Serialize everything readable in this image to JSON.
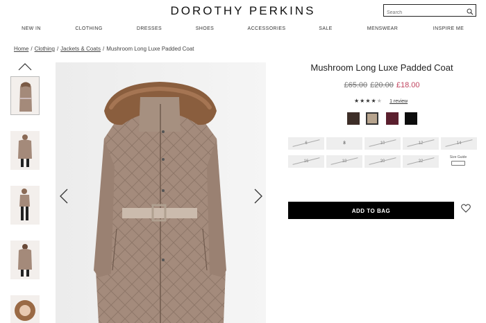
{
  "brand": {
    "logo": "DOROTHY PERKINS"
  },
  "search": {
    "placeholder": "Search"
  },
  "nav": [
    "NEW IN",
    "CLOTHING",
    "DRESSES",
    "SHOES",
    "ACCESSORIES",
    "SALE",
    "MENSWEAR",
    "INSPIRE ME"
  ],
  "breadcrumb": {
    "items": [
      "Home",
      "Clothing",
      "Jackets & Coats"
    ],
    "current": "Mushroom Long Luxe Padded Coat",
    "separator": "/"
  },
  "product": {
    "title": "Mushroom Long Luxe Padded Coat",
    "price_was_1": "£65.00",
    "price_was_2": "£20.00",
    "price_now": "£18.00",
    "rating": 4,
    "rating_max": 5,
    "stars": "★★★★★",
    "reviews": "1 review"
  },
  "swatches": [
    {
      "name": "dark brown",
      "color": "#3d2e28"
    },
    {
      "name": "mushroom",
      "color": "#b7a48e",
      "selected": true
    },
    {
      "name": "burgundy",
      "color": "#5a1f2e"
    },
    {
      "name": "black",
      "color": "#0d0d0d"
    }
  ],
  "sizes": [
    {
      "label": "6",
      "available": false
    },
    {
      "label": "8",
      "available": true
    },
    {
      "label": "10",
      "available": false
    },
    {
      "label": "12",
      "available": false
    },
    {
      "label": "14",
      "available": false
    },
    {
      "label": "16",
      "available": false
    },
    {
      "label": "18",
      "available": false
    },
    {
      "label": "20",
      "available": false
    },
    {
      "label": "22",
      "available": false
    }
  ],
  "size_guide": {
    "label": "Size Guide"
  },
  "cta": {
    "add_to_bag": "ADD TO BAG"
  },
  "colors": {
    "sale_price": "#c0435e",
    "cta_bg": "#000000"
  }
}
